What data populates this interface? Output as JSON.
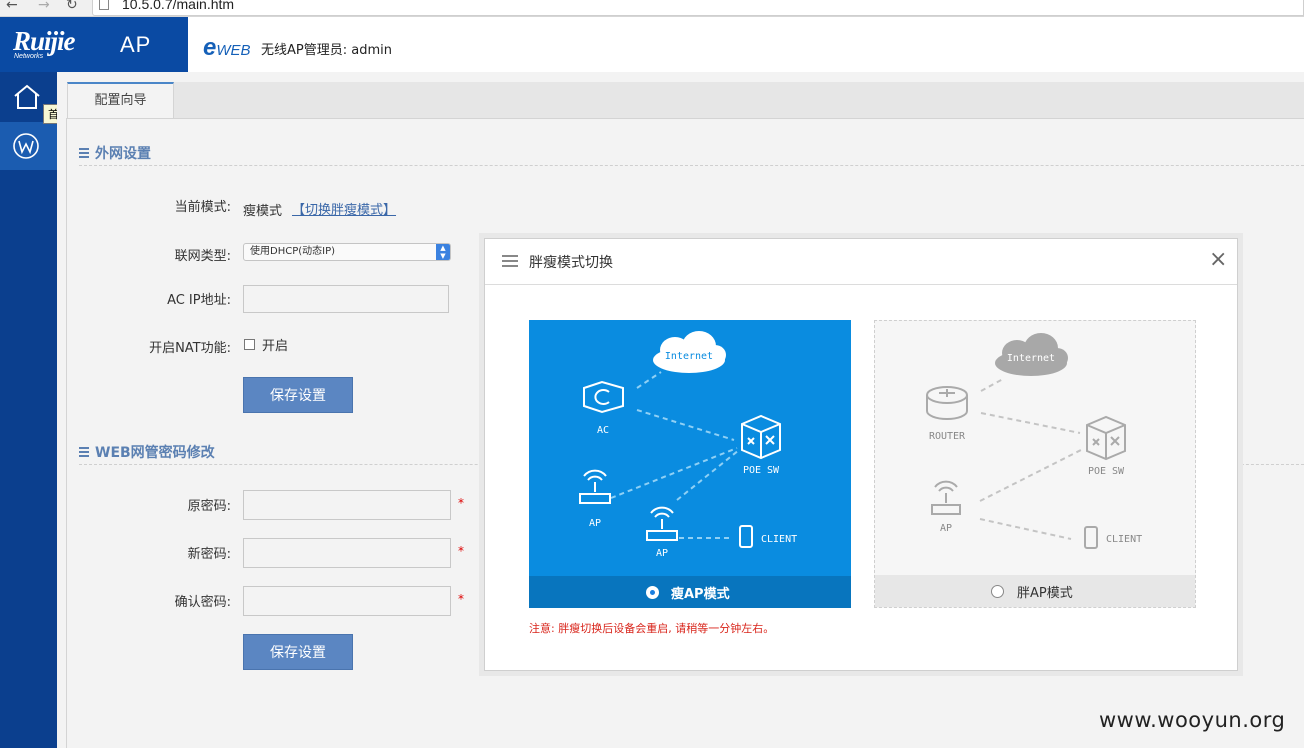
{
  "browser": {
    "url": "10.5.0.7/main.htm"
  },
  "header": {
    "brand": "Ruijie",
    "brand_sub": "Networks",
    "product": "AP",
    "eweb_e": "e",
    "eweb_rest": "WEB",
    "admin_text": "无线AP管理员: admin"
  },
  "sidebar": {
    "tooltip": "首页"
  },
  "tabs": [
    {
      "label": "配置向导"
    }
  ],
  "wan": {
    "title": "外网设置",
    "mode_label": "当前模式:",
    "mode_value": "瘦模式",
    "mode_switch_link": "【切换胖瘦模式】",
    "conn_type_label": "联网类型:",
    "conn_type_value": "使用DHCP(动态IP)",
    "ac_ip_label": "AC IP地址:",
    "nat_label": "开启NAT功能:",
    "nat_checkbox_label": "开启",
    "save_button": "保存设置"
  },
  "password": {
    "title": "WEB网管密码修改",
    "old_label": "原密码:",
    "new_label": "新密码:",
    "confirm_label": "确认密码:",
    "required_mark": "*",
    "save_button": "保存设置"
  },
  "modal": {
    "title": "胖瘦模式切换",
    "thin_mode_label": "瘦AP模式",
    "fat_mode_label": "胖AP模式",
    "selected": "thin",
    "notice": "注意: 胖瘦切换后设备会重启, 请稍等一分钟左右。",
    "thin_diagram": {
      "internet": "Internet",
      "ac": "AC",
      "poe": "POE SW",
      "ap1": "AP",
      "ap2": "AP",
      "client": "CLIENT"
    },
    "fat_diagram": {
      "internet": "Internet",
      "router": "ROUTER",
      "poe": "POE SW",
      "ap": "AP",
      "client": "CLIENT"
    }
  },
  "watermark": "www.wooyun.org"
}
